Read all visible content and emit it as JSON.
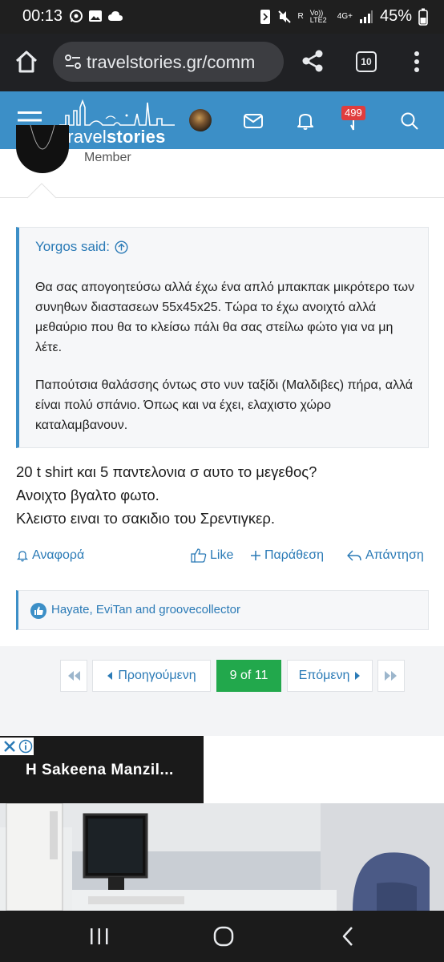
{
  "status_bar": {
    "time": "00:13",
    "battery": "45%",
    "net_r": "R",
    "volte": "Vo)) LTE2",
    "network": "4G+"
  },
  "browser": {
    "url": "travelstories.gr/comm",
    "tab_count": "10"
  },
  "header": {
    "logo_prefix": "travel",
    "logo_suffix": "stories",
    "notification_count": "499"
  },
  "post": {
    "author_role": "Member",
    "quote": {
      "author": "Yorgos said:",
      "paragraph1": "Θα σας απογοητεύσω αλλά έχω ένα απλό μπακπακ μικρότερο των συνηθων διαστασεων 55x45x25. Τώρα το έχω ανοιχτό αλλά μεθαύριο που θα το κλείσω πάλι θα σας στείλω φώτο για να μη λέτε.",
      "paragraph2": "Παπούτσια θαλάσσης όντως στο νυν ταξίδι (Μαλδιβες) πήρα, αλλά είναι πολύ σπάνιο. Όπως και να έχει, ελαχιστο χώρο καταλαμβανουν."
    },
    "body_lines": [
      "20 t shirt και 5 παντελονια σ αυτο το μεγεθος?",
      "Ανοιχτο βγαλτο φωτο.",
      "Κλειστο ειναι το σακιδιο του Σρεντιγκερ."
    ],
    "actions": {
      "report": "Αναφορά",
      "like": "Like",
      "quote": "Παράθεση",
      "reply": "Απάντηση"
    },
    "likes_text": "Hayate, EviTan and groovecollector"
  },
  "pagination": {
    "prev": "Προηγούμενη",
    "current": "9 of 11",
    "next": "Επόμενη"
  },
  "ad": {
    "title": "H Sakeena Manzil..."
  },
  "colors": {
    "header_blue": "#3c8fc7",
    "link_blue": "#2a7ab6",
    "current_page_green": "#22a84c",
    "badge_red": "#e03d3d"
  }
}
